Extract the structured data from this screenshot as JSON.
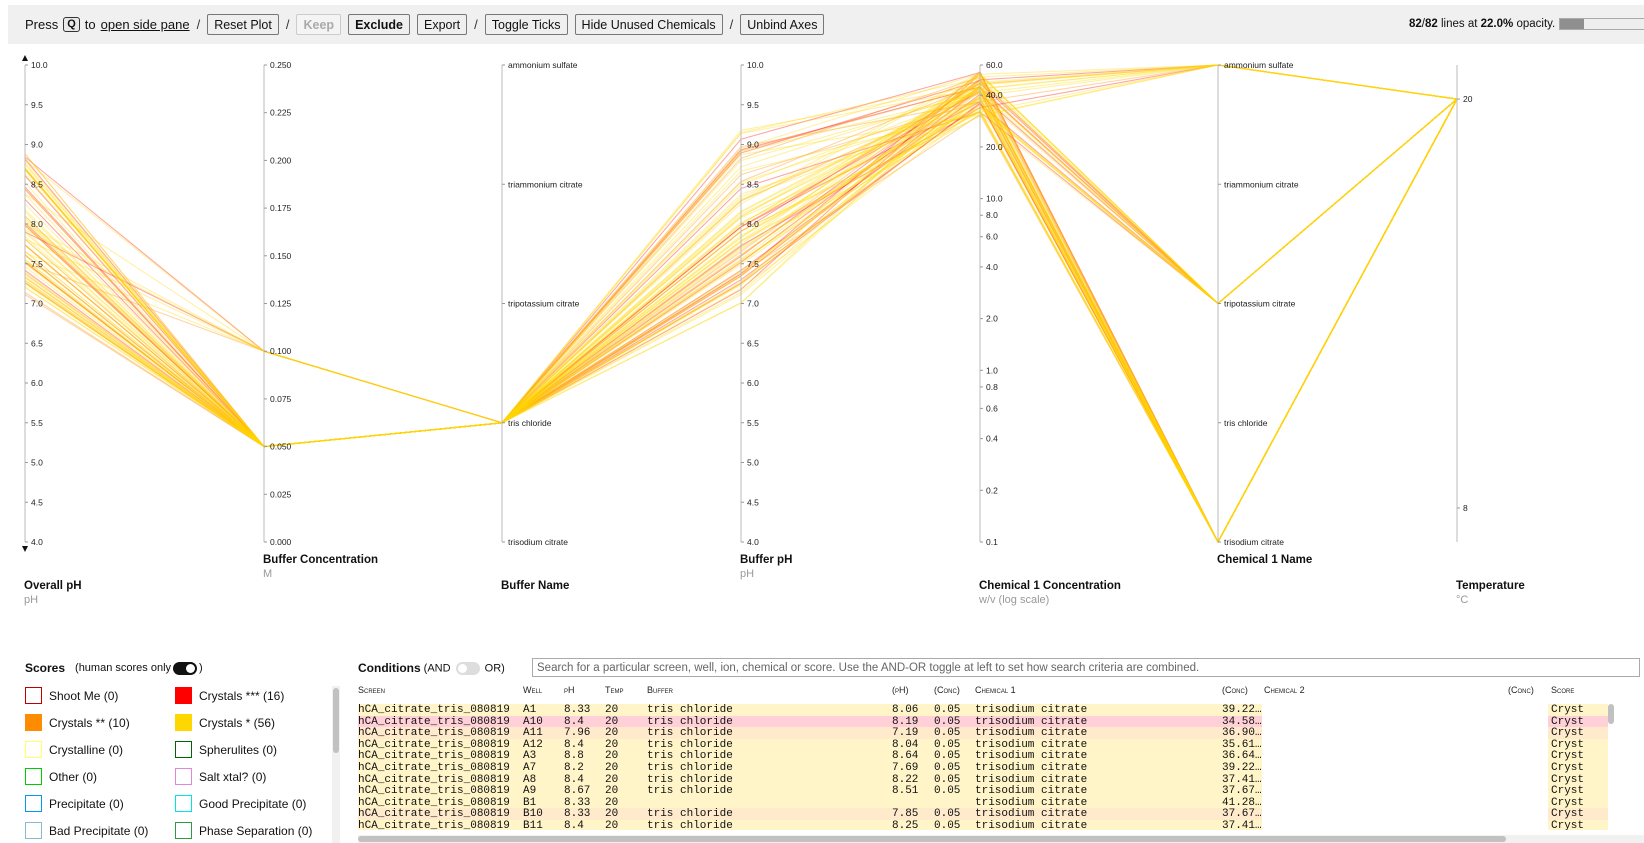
{
  "toolbar": {
    "press_label": "Press",
    "key_label": "Q",
    "to_label": "to",
    "side_pane_link": "open side pane",
    "sep": "/",
    "reset_plot": "Reset Plot",
    "keep": "Keep",
    "exclude": "Exclude",
    "export": "Export",
    "toggle_ticks": "Toggle Ticks",
    "hide_unused": "Hide Unused Chemicals",
    "unbind_axes": "Unbind Axes"
  },
  "status": {
    "shown_lines": "82",
    "total_lines": "82",
    "lines_at_text": "lines at",
    "opacity": "22.0%",
    "opacity_text": "opacity.",
    "opacity_fraction": 0.22
  },
  "chart_data": {
    "type": "parallel-coordinates",
    "colors": {
      "crystals_3": "#ff0000",
      "crystals_2": "#ff8c00",
      "crystals_1": "#ffd700"
    },
    "axes": [
      {
        "key": "ph",
        "title": "Overall pH",
        "unit": "pH",
        "scale": "linear",
        "range": [
          4.0,
          10.0
        ],
        "ticks": [
          "10.0",
          "9.5",
          "9.0",
          "8.5",
          "8.0",
          "7.5",
          "7.0",
          "6.5",
          "6.0",
          "5.5",
          "5.0",
          "4.5",
          "4.0"
        ],
        "brush_arrows": true
      },
      {
        "key": "buffer_conc",
        "title": "Buffer Concentration",
        "unit": "M",
        "scale": "linear",
        "range": [
          0,
          0.25
        ],
        "ticks": [
          "0.250",
          "0.225",
          "0.200",
          "0.175",
          "0.150",
          "0.125",
          "0.100",
          "0.075",
          "0.050",
          "0.025",
          "0.000"
        ]
      },
      {
        "key": "buffer_name",
        "title": "Buffer Name",
        "unit": "",
        "scale": "categorical",
        "categories": [
          "ammonium sulfate",
          "triammonium citrate",
          "tripotassium citrate",
          "tris chloride",
          "trisodium citrate"
        ]
      },
      {
        "key": "buffer_ph",
        "title": "Buffer pH",
        "unit": "pH",
        "scale": "linear",
        "range": [
          4.0,
          10.0
        ],
        "ticks": [
          "10.0",
          "9.5",
          "9.0",
          "8.5",
          "8.0",
          "7.5",
          "7.0",
          "6.5",
          "6.0",
          "5.5",
          "5.0",
          "4.5",
          "4.0"
        ]
      },
      {
        "key": "chem1_conc",
        "title": "Chemical 1 Concentration",
        "unit": "w/v (log scale)",
        "scale": "log",
        "range": [
          0.1,
          60
        ],
        "ticks": [
          "60.0",
          "40.0",
          "20.0",
          "10.0",
          "8.0",
          "6.0",
          "4.0",
          "2.0",
          "1.0",
          "0.8",
          "0.6",
          "0.4",
          "0.2",
          "0.1"
        ]
      },
      {
        "key": "chem1_name",
        "title": "Chemical 1 Name",
        "unit": "",
        "scale": "categorical",
        "categories": [
          "ammonium sulfate",
          "triammonium citrate",
          "tripotassium citrate",
          "tris chloride",
          "trisodium citrate"
        ]
      },
      {
        "key": "temp",
        "title": "Temperature",
        "unit": "°C",
        "scale": "linear",
        "range": [
          7,
          21
        ],
        "ticks": [
          "20",
          "8"
        ]
      }
    ],
    "line_groups": [
      {
        "score": "Crystals ***",
        "color": "#ff0000",
        "count": 16
      },
      {
        "score": "Crystals **",
        "color": "#ff8c00",
        "count": 10
      },
      {
        "score": "Crystals *",
        "color": "#ffd700",
        "count": 56
      }
    ]
  },
  "scores": {
    "title": "Scores",
    "human_only_label": "(human scores only",
    "close_paren": ")",
    "items": [
      {
        "label": "Shoot Me (0)",
        "color": "#c00000",
        "filled": false
      },
      {
        "label": "Crystals *** (16)",
        "color": "#ff0000",
        "filled": true
      },
      {
        "label": "Crystals ** (10)",
        "color": "#ff8c00",
        "filled": true
      },
      {
        "label": "Crystals * (56)",
        "color": "#ffd700",
        "filled": true
      },
      {
        "label": "Crystalline (0)",
        "color": "#ffff66",
        "filled": false
      },
      {
        "label": "Spherulites (0)",
        "color": "#006400",
        "filled": false
      },
      {
        "label": "Other (0)",
        "color": "#00cc00",
        "filled": false
      },
      {
        "label": "Salt xtal? (0)",
        "color": "#dd88dd",
        "filled": false
      },
      {
        "label": "Precipitate (0)",
        "color": "#0099ee",
        "filled": false
      },
      {
        "label": "Good Precipitate (0)",
        "color": "#00e5e5",
        "filled": false
      },
      {
        "label": "Bad Precipitate (0)",
        "color": "#88bbcc",
        "filled": false
      },
      {
        "label": "Phase Separation (0)",
        "color": "#339944",
        "filled": false
      }
    ]
  },
  "conditions": {
    "title": "Conditions",
    "and_label": "(AND",
    "or_label": "OR)",
    "search_placeholder": "Search for a particular screen, well, ion, chemical or score. Use the AND-OR toggle at left to set how search criteria are combined.",
    "columns": [
      "Screen",
      "Well",
      "pH",
      "Temp",
      "Buffer",
      "(pH)",
      "(Conc)",
      "Chemical 1",
      "(Conc)",
      "Chemical 2",
      "(Conc)",
      "Score"
    ],
    "rows": [
      [
        "hCA_citrate_tris_080819",
        "A1",
        "8.33",
        "20",
        "tris chloride",
        "8.06",
        "0.05",
        "trisodium citrate",
        "39.22…",
        "",
        "",
        "Cryst"
      ],
      [
        "hCA_citrate_tris_080819",
        "A10",
        "8.4",
        "20",
        "tris chloride",
        "8.19",
        "0.05",
        "trisodium citrate",
        "34.58…",
        "",
        "",
        "Cryst"
      ],
      [
        "hCA_citrate_tris_080819",
        "A11",
        "7.96",
        "20",
        "tris chloride",
        "7.19",
        "0.05",
        "trisodium citrate",
        "36.90…",
        "",
        "",
        "Cryst"
      ],
      [
        "hCA_citrate_tris_080819",
        "A12",
        "8.4",
        "20",
        "tris chloride",
        "8.04",
        "0.05",
        "trisodium citrate",
        "35.61…",
        "",
        "",
        "Cryst"
      ],
      [
        "hCA_citrate_tris_080819",
        "A3",
        "8.8",
        "20",
        "tris chloride",
        "8.64",
        "0.05",
        "trisodium citrate",
        "36.64…",
        "",
        "",
        "Cryst"
      ],
      [
        "hCA_citrate_tris_080819",
        "A7",
        "8.2",
        "20",
        "tris chloride",
        "7.69",
        "0.05",
        "trisodium citrate",
        "39.22…",
        "",
        "",
        "Cryst"
      ],
      [
        "hCA_citrate_tris_080819",
        "A8",
        "8.4",
        "20",
        "tris chloride",
        "8.22",
        "0.05",
        "trisodium citrate",
        "37.41…",
        "",
        "",
        "Cryst"
      ],
      [
        "hCA_citrate_tris_080819",
        "A9",
        "8.67",
        "20",
        "tris chloride",
        "8.51",
        "0.05",
        "trisodium citrate",
        "37.67…",
        "",
        "",
        "Cryst"
      ],
      [
        "hCA_citrate_tris_080819",
        "B1",
        "8.33",
        "20",
        "",
        "",
        "",
        "trisodium citrate",
        "41.28…",
        "",
        "",
        "Cryst"
      ],
      [
        "hCA_citrate_tris_080819",
        "B10",
        "8.33",
        "20",
        "tris chloride",
        "7.85",
        "0.05",
        "trisodium citrate",
        "37.67…",
        "",
        "",
        "Cryst"
      ],
      [
        "hCA_citrate_tris_080819",
        "B11",
        "8.4",
        "20",
        "tris chloride",
        "8.25",
        "0.05",
        "trisodium citrate",
        "37.41…",
        "",
        "",
        "Cryst"
      ]
    ],
    "row_colors": [
      "#fff5c8",
      "#ffd0d8",
      "#ffeacc",
      "#fff5c8",
      "#fff5c8",
      "#fff5c8",
      "#fff5c8",
      "#fff5c8",
      "#fff5c8",
      "#ffeacc",
      "#fff5c8"
    ]
  }
}
